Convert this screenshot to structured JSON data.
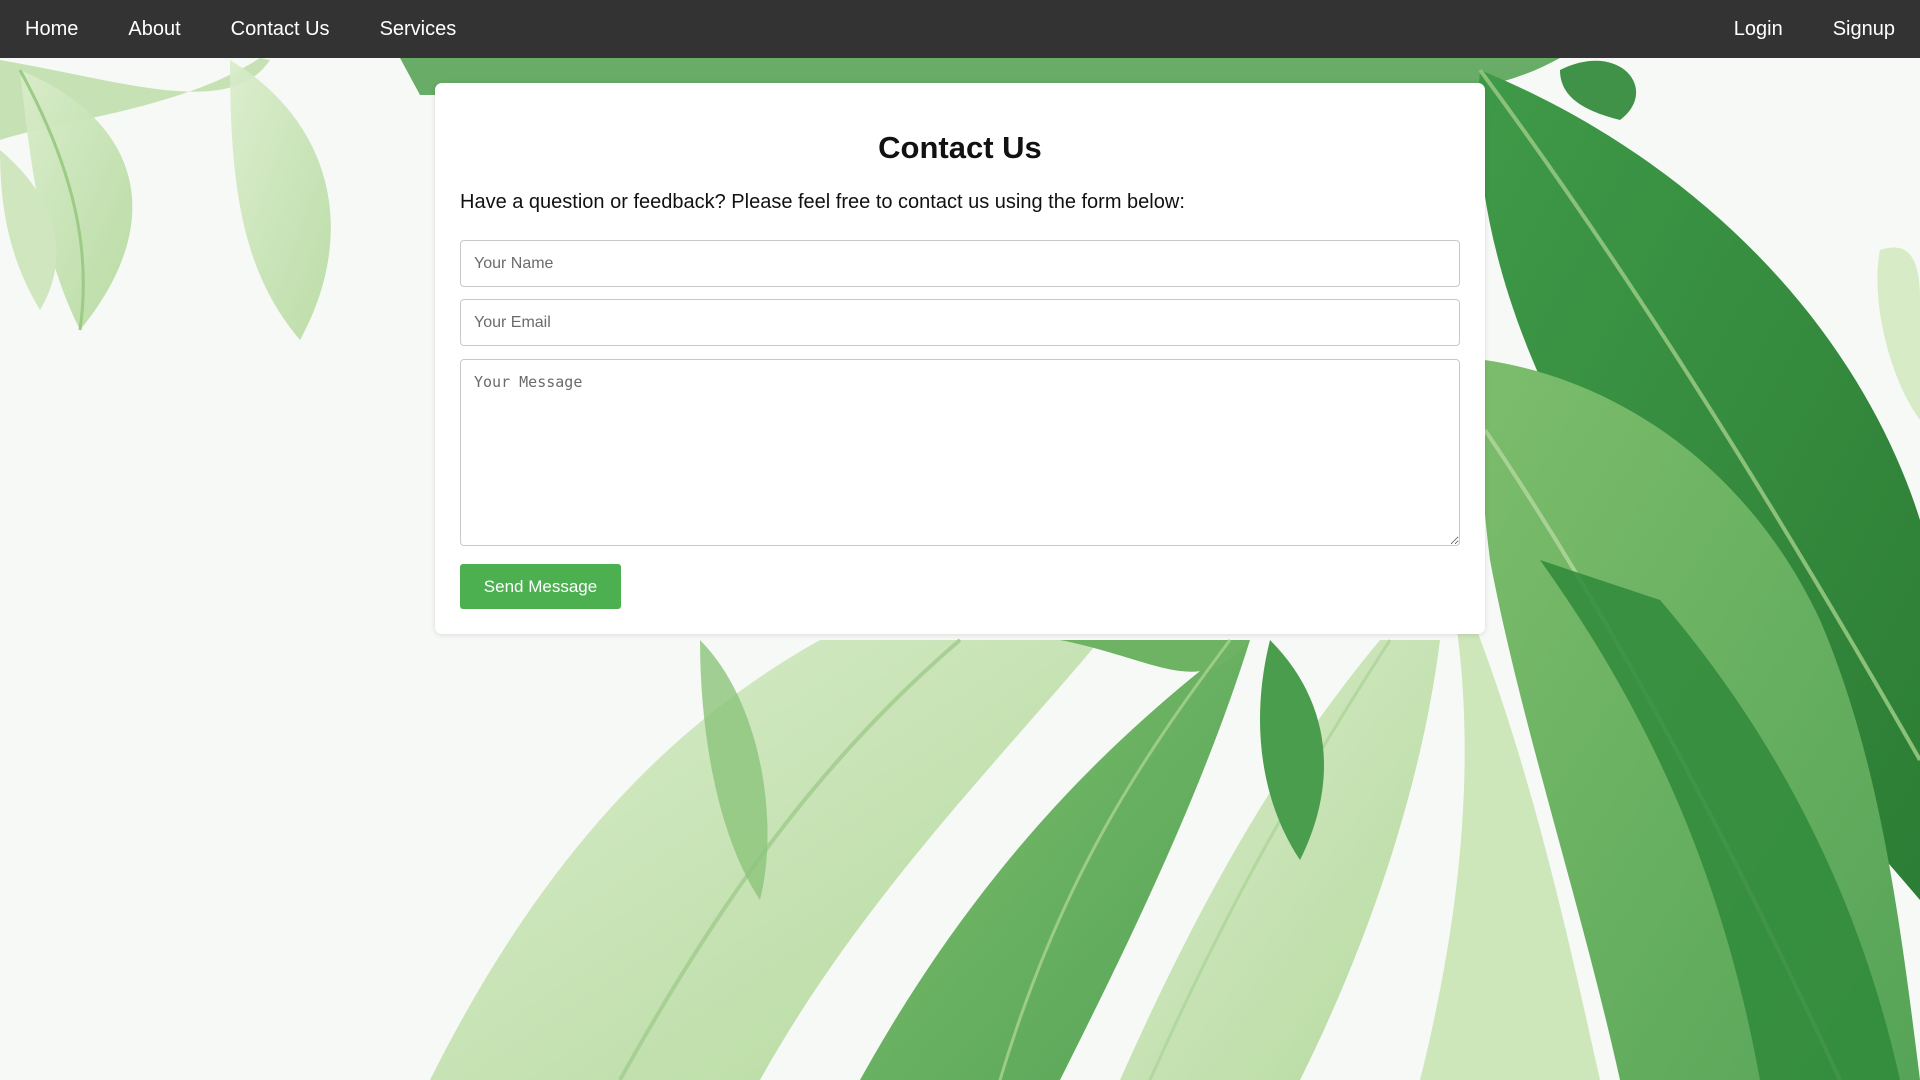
{
  "nav": {
    "left": [
      {
        "label": "Home"
      },
      {
        "label": "About"
      },
      {
        "label": "Contact Us"
      },
      {
        "label": "Services"
      }
    ],
    "right": [
      {
        "label": "Login"
      },
      {
        "label": "Signup"
      }
    ],
    "background_color": "#333333",
    "text_color": "#ffffff"
  },
  "contact": {
    "title": "Contact Us",
    "description": "Have a question or feedback? Please feel free to contact us using the form below:",
    "name_placeholder": "Your Name",
    "email_placeholder": "Your Email",
    "message_placeholder": "Your Message",
    "submit_label": "Send Message",
    "button_color": "#4caf50"
  },
  "background": {
    "icon": "green-leaves-photo",
    "colors": [
      "#2e8b3a",
      "#57a85a",
      "#a7d394",
      "#dcedce"
    ]
  }
}
